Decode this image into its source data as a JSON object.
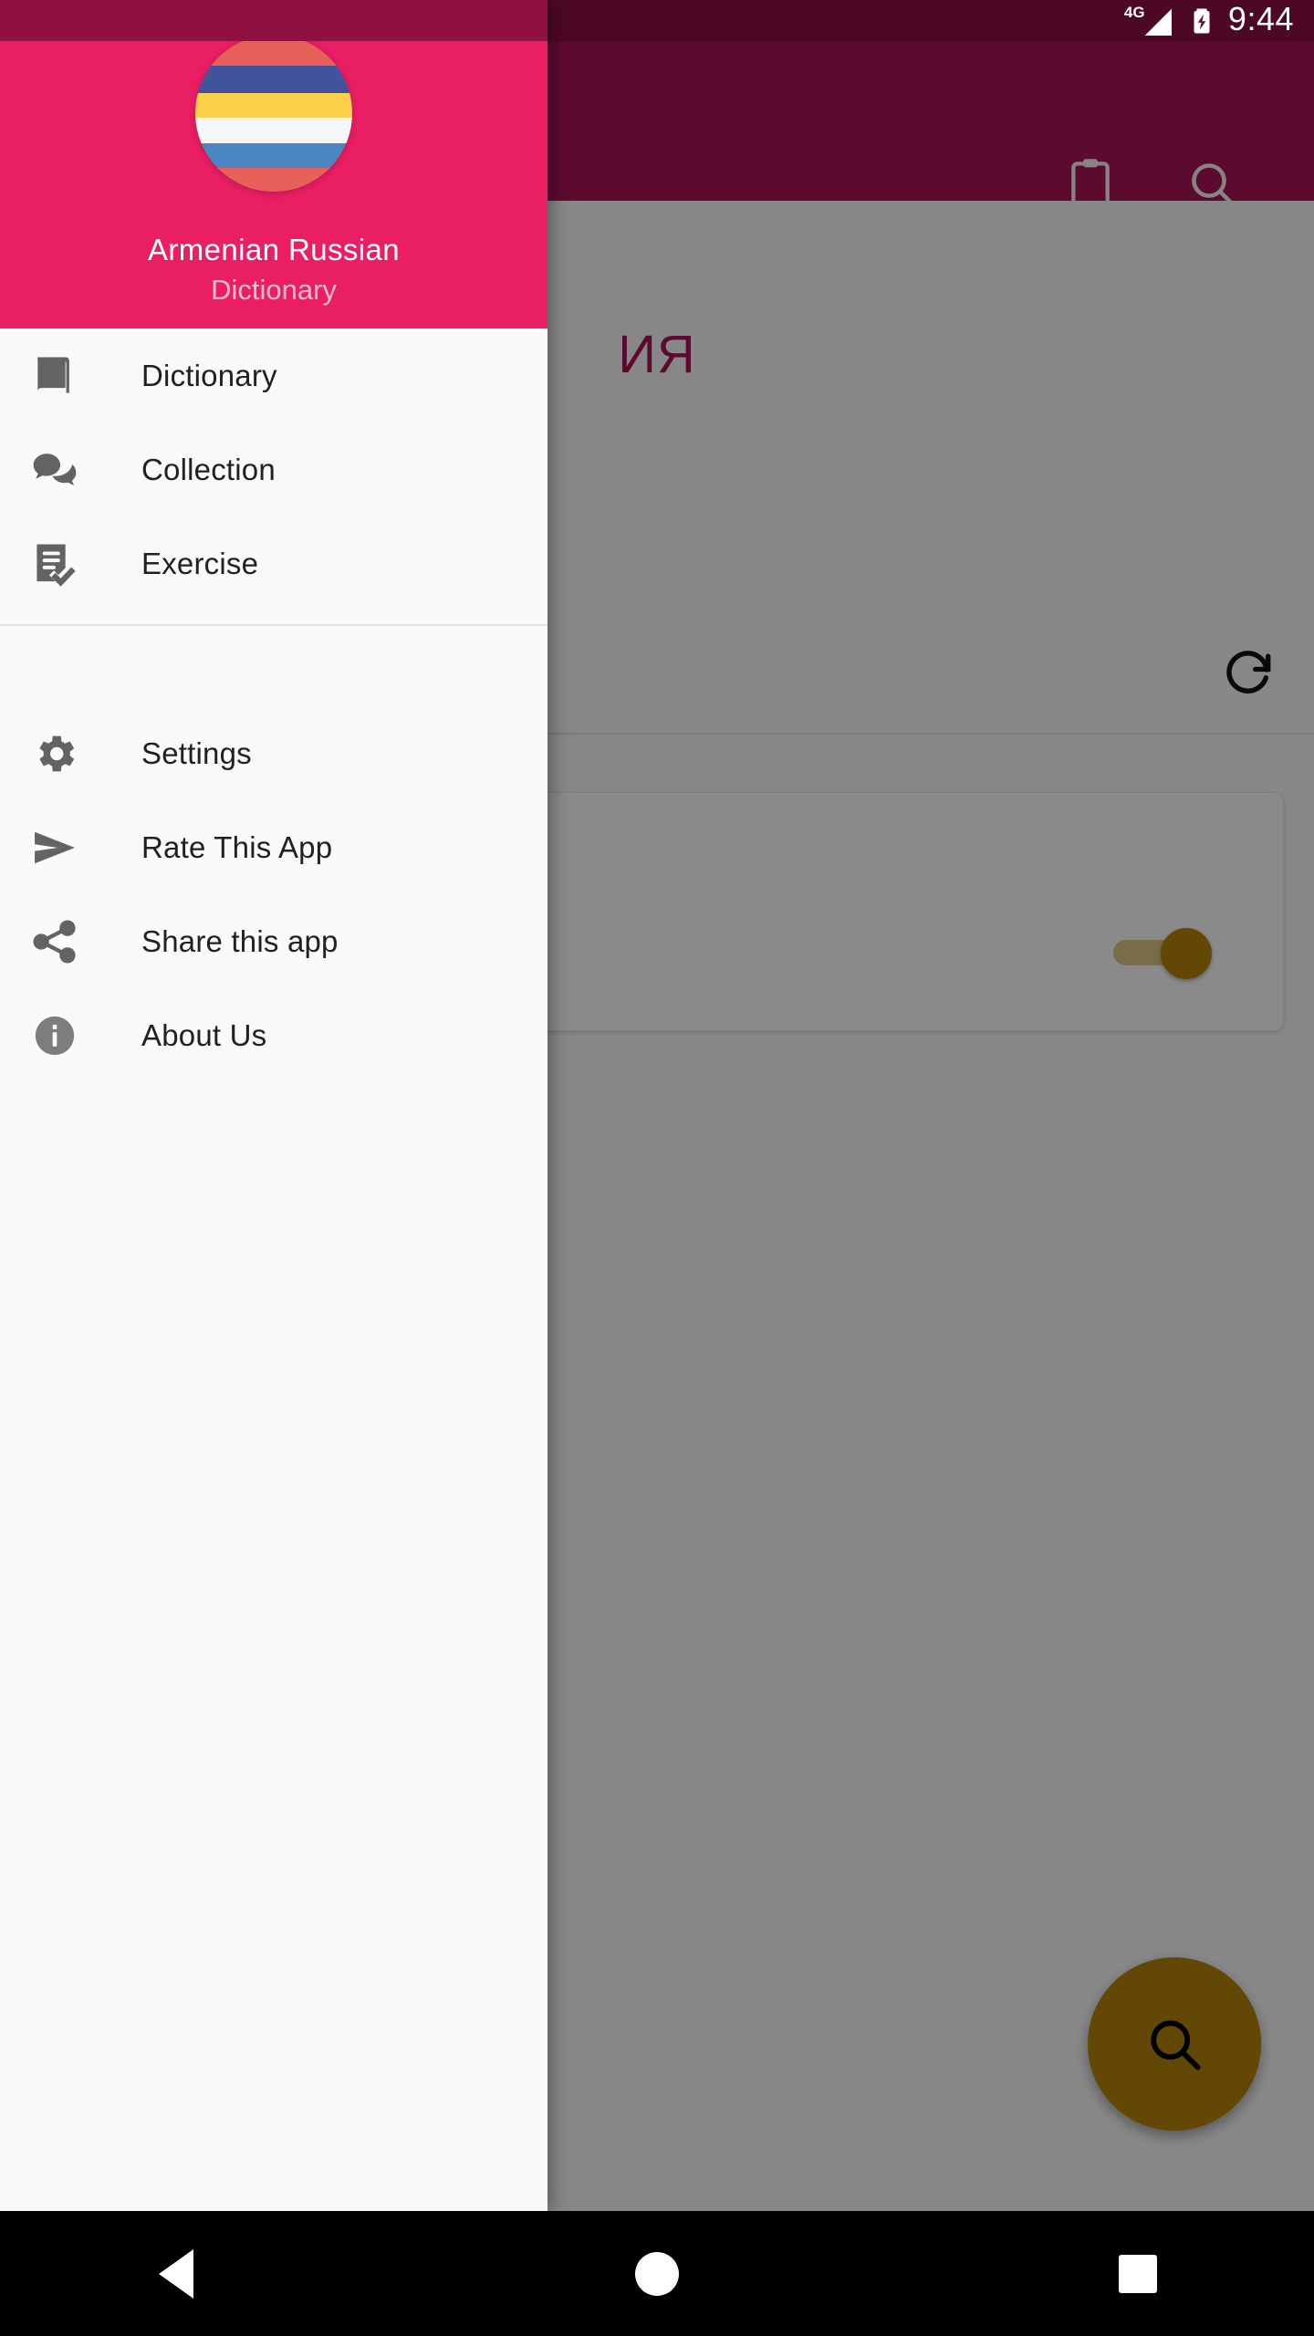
{
  "statusbar": {
    "network_label": "4G",
    "time": "9:44",
    "battery_icon": "battery-charging-icon",
    "signal_icon": "signal-bars-icon"
  },
  "background_app": {
    "appbar": {
      "background_color": "#AD1457",
      "actions": [
        {
          "name": "clipboard-icon",
          "label": "Clipboard"
        },
        {
          "name": "search-icon",
          "label": "Search"
        }
      ]
    },
    "heading": "ИЯ",
    "refresh_icon": "refresh-icon",
    "card": {
      "toggle": {
        "name": "toggle-switch",
        "state": "on",
        "color": "#B8860B"
      }
    },
    "fab": {
      "name": "search-fab",
      "icon": "search-icon",
      "color": "#B8860B"
    }
  },
  "drawer": {
    "header": {
      "background_color": "#E91E63",
      "logo_icon": "armenian-russian-flag-logo",
      "logo_stripes": [
        {
          "color": "#E8605A",
          "height": 20
        },
        {
          "color": "#41549B",
          "height": 17
        },
        {
          "color": "#FCD04B",
          "height": 16
        },
        {
          "color": "#F4F6F8",
          "height": 16
        },
        {
          "color": "#4C86C2",
          "height": 16
        },
        {
          "color": "#E8605A",
          "height": 15
        }
      ],
      "title": "Armenian  Russian",
      "subtitle": "Dictionary"
    },
    "primary_items": [
      {
        "id": "dictionary",
        "label": "Dictionary",
        "icon": "book-icon"
      },
      {
        "id": "collection",
        "label": "Collection",
        "icon": "chat-bubbles-icon"
      },
      {
        "id": "exercise",
        "label": "Exercise",
        "icon": "document-check-icon"
      }
    ],
    "secondary_items": [
      {
        "id": "settings",
        "label": "Settings",
        "icon": "gear-icon"
      },
      {
        "id": "rate",
        "label": "Rate This App",
        "icon": "send-icon"
      },
      {
        "id": "share",
        "label": "Share this app",
        "icon": "share-icon"
      },
      {
        "id": "about",
        "label": "About Us",
        "icon": "info-icon"
      }
    ]
  },
  "navbar": {
    "back_label": "Back",
    "home_label": "Home",
    "recents_label": "Recent apps"
  }
}
